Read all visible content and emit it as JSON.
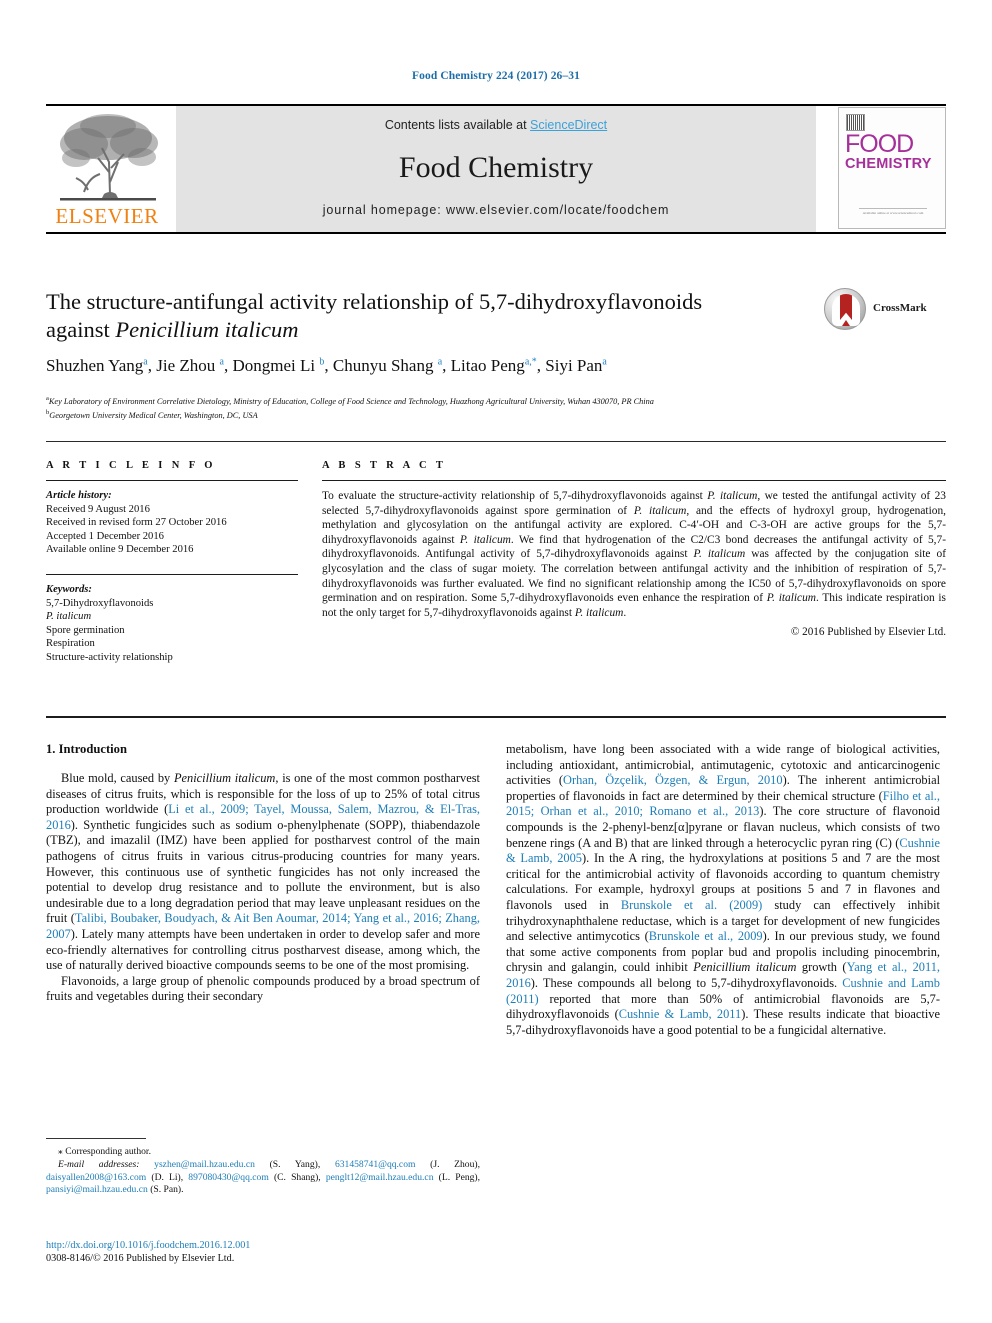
{
  "running_head": "Food Chemistry 224 (2017) 26–31",
  "masthead": {
    "publisher_name": "ELSEVIER",
    "contents_prefix": "Contents lists available at ",
    "sciencedirect": "ScienceDirect",
    "journal_name": "Food Chemistry",
    "homepage": "journal homepage: www.elsevier.com/locate/foodchem",
    "cover": {
      "food": "FOOD",
      "chemistry": "CHEMISTRY",
      "footer": "Available online at www.sciencedirect.com"
    }
  },
  "article": {
    "title_line1": "The structure-antifungal activity relationship of 5,7-dihydroxyflavonoids",
    "title_line2_pre": "against ",
    "title_line2_italic": "Penicillium italicum",
    "crossmark_label": "CrossMark",
    "authors_html": "Shuzhen Yang<sup>a</sup>, Jie Zhou <sup>a</sup>, Dongmei Li <sup>b</sup>, Chunyu Shang <sup>a</sup>, Litao Peng<sup>a,*</sup>, Siyi Pan<sup>a</sup>",
    "affiliation_a": "Key Laboratory of Environment Correlative Dietology, Ministry of Education, College of Food Science and Technology, Huazhong Agricultural University, Wuhan 430070, PR China",
    "affiliation_b": "Georgetown University Medical Center, Washington, DC, USA"
  },
  "article_info": {
    "heading": "A R T I C L E   I N F O",
    "history_label": "Article history:",
    "history": [
      "Received 9 August 2016",
      "Received in revised form 27 October 2016",
      "Accepted 1 December 2016",
      "Available online 9 December 2016"
    ],
    "keywords_label": "Keywords:",
    "keywords": [
      "5,7-Dihydroxyflavonoids",
      "P. italicum",
      "Spore germination",
      "Respiration",
      "Structure-activity relationship"
    ]
  },
  "abstract": {
    "heading": "A B S T R A C T",
    "text_html": "To evaluate the structure-activity relationship of 5,7-dihydroxyflavonoids against <em>P. italicum</em>, we tested the antifungal activity of 23 selected 5,7-dihydroxyflavonoids against spore germination of <em>P. italicum</em>, and the effects of hydroxyl group, hydrogenation, methylation and glycosylation on the antifungal activity are explored. C-4′-OH and C-3-OH are active groups for the 5,7-dihydroxyflavonoids against <em>P. italicum</em>. We find that hydrogenation of the C2/C3 bond decreases the antifungal activity of 5,7-dihydroxyflavonoids. Antifungal activity of 5,7-dihydroxyflavonoids against <em>P. italicum</em> was affected by the conjugation site of glycosylation and the class of sugar moiety. The correlation between antifungal activity and the inhibition of respiration of 5,7-dihydroxyflavonoids was further evaluated. We find no significant relationship among the IC50 of 5,7-dihydroxyflavonoids on spore germination and on respiration. Some 5,7-dihydroxyflavonoids even enhance the respiration of <em>P. italicum</em>. This indicate respiration is not the only target for 5,7-dihydroxyflavonoids against <em>P. italicum</em>.",
    "copyright": "© 2016 Published by Elsevier Ltd."
  },
  "body": {
    "section_heading": "1. Introduction",
    "left_p1_html": "Blue mold, caused by <em>Penicillium italicum</em>, is one of the most common postharvest diseases of citrus fruits, which is responsible for the loss of up to 25% of total citrus production worldwide (<span class=\"ref\">Li et al., 2009; Tayel, Moussa, Salem, Mazrou, &amp; El-Tras, 2016</span>). Synthetic fungicides such as sodium o-phenylphenate (SOPP), thiabendazole (TBZ), and imazalil (IMZ) have been applied for postharvest control of the main pathogens of citrus fruits in various citrus-producing countries for many years. However, this continuous use of synthetic fungicides has not only increased the potential to develop drug resistance and to pollute the environment, but is also undesirable due to a long degradation period that may leave unpleasant residues on the fruit (<span class=\"ref\">Talibi, Boubaker, Boudyach, &amp; Ait Ben Aoumar, 2014; Yang et al., 2016; Zhang, 2007</span>). Lately many attempts have been undertaken in order to develop safer and more eco-friendly alternatives for controlling citrus postharvest disease, among which, the use of naturally derived bioactive compounds seems to be one of the most promising.",
    "left_p2_html": "Flavonoids, a large group of phenolic compounds produced by a broad spectrum of fruits and vegetables during their secondary",
    "right_p1_html": "metabolism, have long been associated with a wide range of biological activities, including antioxidant, antimicrobial, antimutagenic, cytotoxic and anticarcinogenic activities (<span class=\"ref\">Orhan, Özçelik, Özgen, &amp; Ergun, 2010</span>). The inherent antimicrobial properties of flavonoids in fact are determined by their chemical structure (<span class=\"ref\">Filho et al., 2015; Orhan et al., 2010; Romano et al., 2013</span>). The core structure of flavonoid compounds is the 2-phenyl-benz[α]pyrane or flavan nucleus, which consists of two benzene rings (A and B) that are linked through a heterocyclic pyran ring (C) (<span class=\"ref\">Cushnie &amp; Lamb, 2005</span>). In the A ring, the hydroxylations at positions 5 and 7 are the most critical for the antimicrobial activity of flavonoids according to quantum chemistry calculations. For example, hydroxyl groups at positions 5 and 7 in flavones and flavonols used in <span class=\"ref\">Brunskole et al. (2009)</span> study can effectively inhibit trihydroxynaphthalene reductase, which is a target for development of new fungicides and selective antimycotics (<span class=\"ref\">Brunskole et al., 2009</span>). In our previous study, we found that some active components from poplar bud and propolis including pinocembrin, chrysin and galangin, could inhibit <em>Penicillium italicum</em> growth (<span class=\"ref\">Yang et al., 2011, 2016</span>). These compounds all belong to 5,7-dihydroxyflavonoids. <span class=\"ref\">Cushnie and Lamb (2011)</span> reported that more than 50% of antimicrobial flavonoids are 5,7-dihydroxyflavonoids (<span class=\"ref\">Cushnie &amp; Lamb, 2011</span>). These results indicate that bioactive 5,7-dihydroxyflavonoids have a good potential to be a fungicidal alternative."
  },
  "footnotes": {
    "corresponding_html": "⁎ Corresponding author.",
    "emails_html": "<em>E-mail addresses:</em> <span class=\"mail\">yszhen@mail.hzau.edu.cn</span> (S. Yang), <span class=\"mail\">631458741@qq.com</span> (J. Zhou), <span class=\"mail\">daisyallen2008@163.com</span> (D. Li), <span class=\"mail\">897080430@qq.com</span> (C. Shang), <span class=\"mail\">penglt12@mail.hzau.edu.cn</span> (L. Peng), <span class=\"mail\">pansiyi@mail.hzau.edu.cn</span> (S. Pan).",
    "doi": "http://dx.doi.org/10.1016/j.foodchem.2016.12.001",
    "issn_line": "0308-8146/© 2016 Published by Elsevier Ltd."
  },
  "colors": {
    "link_blue": "#1d7eb8",
    "sciencedirect_blue": "#3ca1d8",
    "elsevier_orange": "#f08010",
    "cover_magenta": "#a6309a"
  }
}
